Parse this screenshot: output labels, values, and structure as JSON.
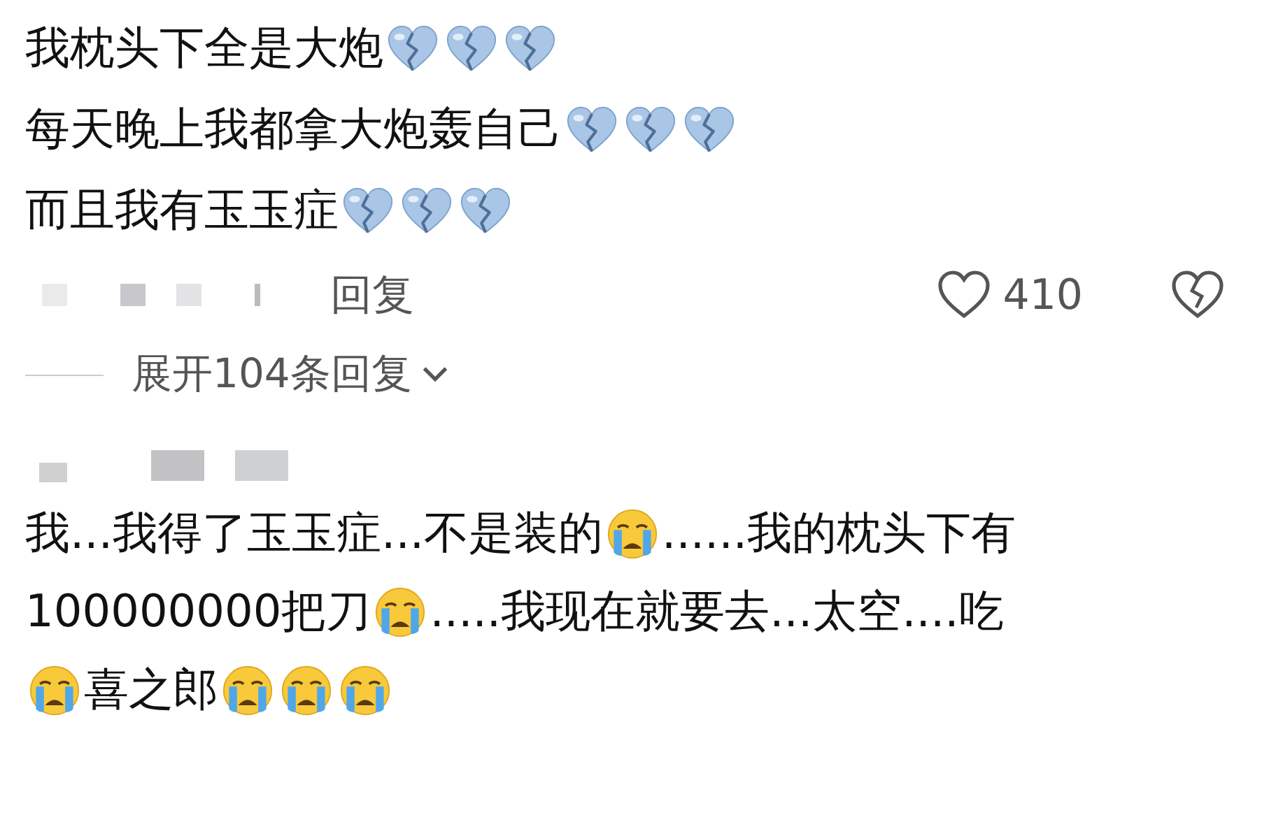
{
  "comments": [
    {
      "lines": [
        [
          {
            "kind": "text",
            "text": "我枕头下全是大炮"
          },
          {
            "kind": "broken-heart"
          },
          {
            "kind": "broken-heart"
          },
          {
            "kind": "broken-heart"
          }
        ],
        [
          {
            "kind": "text",
            "text": "每天晚上我都拿大炮轰自己"
          },
          {
            "kind": "broken-heart"
          },
          {
            "kind": "broken-heart"
          },
          {
            "kind": "broken-heart"
          }
        ],
        [
          {
            "kind": "text",
            "text": "而且我有玉玉症"
          },
          {
            "kind": "broken-heart"
          },
          {
            "kind": "broken-heart"
          },
          {
            "kind": "broken-heart"
          }
        ]
      ],
      "reply_label": "回复",
      "likes": "410",
      "expand_label": "展开104条回复"
    },
    {
      "lines": [
        [
          {
            "kind": "text",
            "text": "我...我得了玉玉症...不是装的"
          },
          {
            "kind": "crying"
          },
          {
            "kind": "text",
            "text": "......我的枕头下有"
          }
        ],
        [
          {
            "kind": "text",
            "text": "100000000把刀"
          },
          {
            "kind": "crying"
          },
          {
            "kind": "text",
            "text": ".....我现在就要去...太空....吃"
          }
        ],
        [
          {
            "kind": "crying"
          },
          {
            "kind": "text",
            "text": "喜之郎"
          },
          {
            "kind": "crying"
          },
          {
            "kind": "crying"
          },
          {
            "kind": "crying"
          }
        ]
      ]
    }
  ]
}
